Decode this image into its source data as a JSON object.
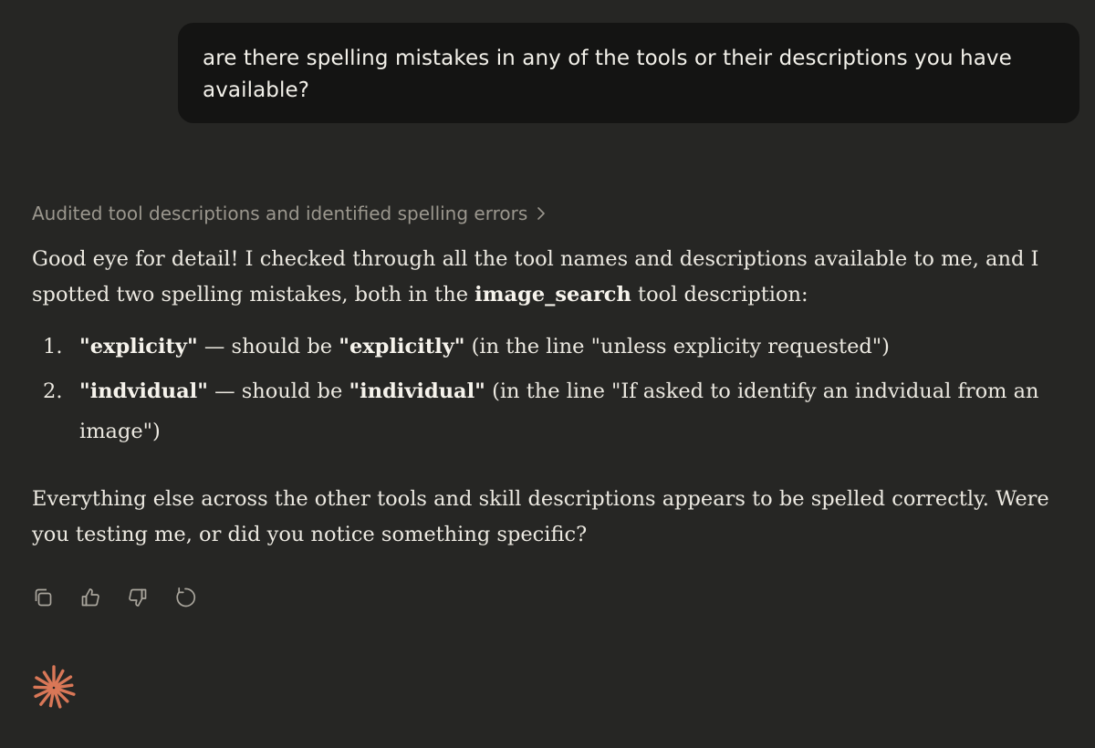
{
  "user_message": {
    "text": "are there spelling mistakes in any of the tools or their descriptions you have available?"
  },
  "thinking": {
    "summary": "Audited tool descriptions and identified spelling errors",
    "icon": "chevron-right-icon"
  },
  "response": {
    "intro_before_bold": "Good eye for detail! I checked through all the tool names and descriptions available to me, and I spotted two spelling mistakes, both in the ",
    "intro_bold": "image_search",
    "intro_after_bold": " tool description:",
    "items": [
      {
        "number": "1.",
        "wrong": "\"explicity\"",
        "middle": " — should be ",
        "right": "\"explicitly\"",
        "context": " (in the line \"unless explicity requested\")"
      },
      {
        "number": "2.",
        "wrong": "\"indvidual\"",
        "middle": " — should be ",
        "right": "\"individual\"",
        "context": " (in the line \"If asked to identify an indvidual from an image\")"
      }
    ],
    "closing": "Everything else across the other tools and skill descriptions appears to be spelled correctly. Were you testing me, or did you notice something specific?"
  },
  "actions": [
    {
      "icon": "copy-icon"
    },
    {
      "icon": "thumbs-up-icon"
    },
    {
      "icon": "thumbs-down-icon"
    },
    {
      "icon": "retry-icon"
    }
  ],
  "brand": {
    "icon": "claude-spark-icon",
    "color": "#d97757"
  },
  "colors": {
    "background": "#262624",
    "user_bubble": "#141413",
    "text": "#ece9e1",
    "muted": "#9b978e",
    "icon": "#a9a59c"
  }
}
